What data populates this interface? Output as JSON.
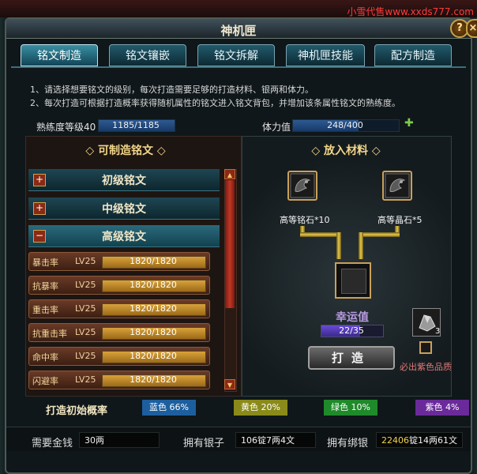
{
  "watermark": "小雪代售www.xxds777.com",
  "window": {
    "title": "神机匣",
    "help_label": "?",
    "close_label": "×"
  },
  "tabs": [
    {
      "label": "铭文制造",
      "active": true
    },
    {
      "label": "铭文镶嵌",
      "active": false
    },
    {
      "label": "铭文拆解",
      "active": false
    },
    {
      "label": "神机匣技能",
      "active": false
    },
    {
      "label": "配方制造",
      "active": false
    }
  ],
  "instructions": [
    "1、请选择想要铭文的级别，每次打造需要足够的打造材料、银两和体力。",
    "2、每次打造可根据打造概率获得随机属性的铭文进入铭文背包，并增加该条属性铭文的熟练度。"
  ],
  "proficiency": {
    "label": "熟练度等级40",
    "value": "1185/1185",
    "fraction": 1.0
  },
  "stamina": {
    "label": "体力值",
    "value": "248/400",
    "fraction": 0.62,
    "add_label": "✚"
  },
  "left_panel": {
    "title": "◇ 可制造铭文 ◇",
    "categories": [
      {
        "icon": "+",
        "label": "初级铭文"
      },
      {
        "icon": "+",
        "label": "中级铭文"
      },
      {
        "icon": "−",
        "label": "高级铭文"
      }
    ],
    "rows": [
      {
        "name": "暴击率",
        "level": "LV25",
        "value": "1820/1820",
        "fraction": 1.0
      },
      {
        "name": "抗暴率",
        "level": "LV25",
        "value": "1820/1820",
        "fraction": 1.0
      },
      {
        "name": "重击率",
        "level": "LV25",
        "value": "1820/1820",
        "fraction": 1.0
      },
      {
        "name": "抗重击率",
        "level": "LV25",
        "value": "1820/1820",
        "fraction": 1.0
      },
      {
        "name": "命中率",
        "level": "LV25",
        "value": "1820/1820",
        "fraction": 1.0
      },
      {
        "name": "闪避率",
        "level": "LV25",
        "value": "1820/1820",
        "fraction": 1.0
      }
    ],
    "scroll_up": "▲",
    "scroll_down": "▼"
  },
  "right_panel": {
    "title": "◇ 放入材料 ◇",
    "materials": [
      {
        "label": "高等铭石*10",
        "icon": "dragon-seal-icon"
      },
      {
        "label": "高等晶石*5",
        "icon": "dragon-seal-icon"
      }
    ],
    "luck_label": "幸运值",
    "luck_value": "22/35",
    "luck_fraction": 0.629,
    "forge_label": "打造",
    "stone_count": "3",
    "purple_label": "必出紫色品质"
  },
  "chances": {
    "title": "打造初始概率",
    "items": [
      {
        "label": "蓝色 66%",
        "color": "#1d5f9e"
      },
      {
        "label": "黄色 20%",
        "color": "#8a8a1a"
      },
      {
        "label": "绿色 10%",
        "color": "#1f8a2a"
      },
      {
        "label": "紫色 4%",
        "color": "#6a2a9a"
      }
    ]
  },
  "bottom": {
    "need_label": "需要金钱",
    "need_value": "30两",
    "silver_label": "拥有银子",
    "silver_value": "106锭7两4文",
    "bound_label": "拥有绑银",
    "bound_value_prefix": "22406",
    "bound_value_rest": "锭14两61文"
  }
}
